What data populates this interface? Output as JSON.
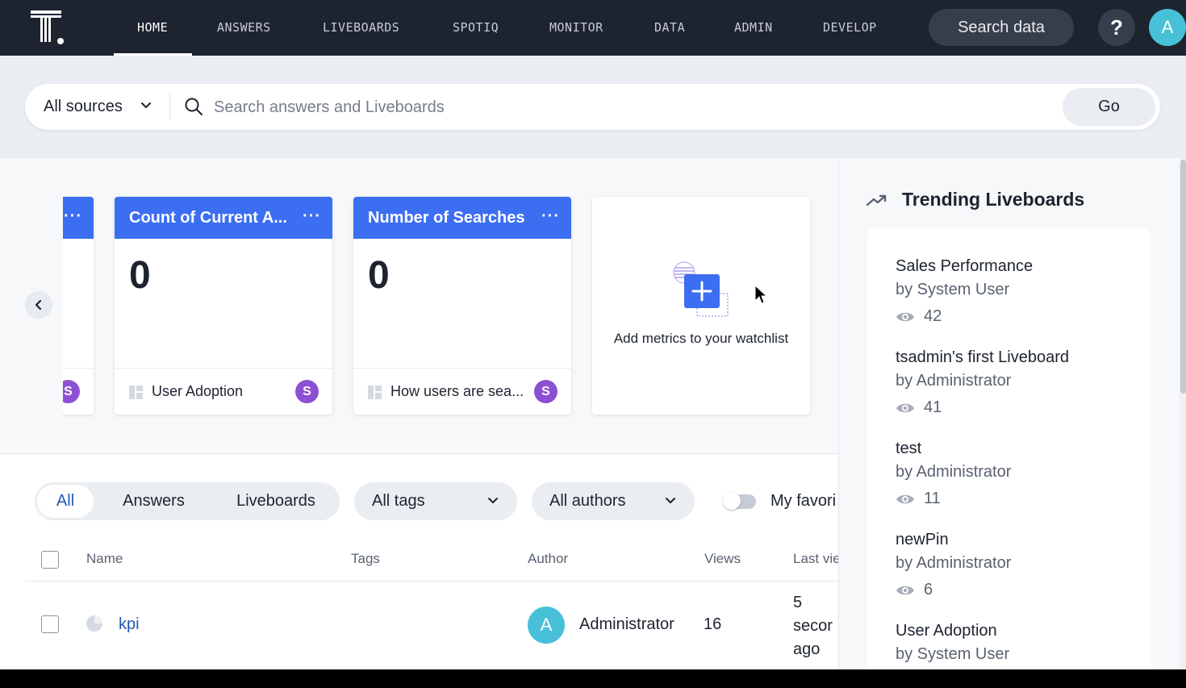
{
  "topnav": {
    "tabs": [
      "HOME",
      "ANSWERS",
      "LIVEBOARDS",
      "SPOTIQ",
      "MONITOR",
      "DATA",
      "ADMIN",
      "DEVELOP"
    ],
    "active_tab": "HOME",
    "search_data_label": "Search data",
    "help_label": "?",
    "avatar_initial": "A"
  },
  "search": {
    "sources_label": "All sources",
    "placeholder": "Search answers and Liveboards",
    "go_label": "Go"
  },
  "watchlist": {
    "partial_card": {
      "more": "···",
      "badge": "S"
    },
    "cards": [
      {
        "title": "Count of Current A...",
        "more": "···",
        "value": "0",
        "source": "User Adoption",
        "badge": "S"
      },
      {
        "title": "Number of Searches",
        "more": "···",
        "value": "0",
        "source": "How users are sea...",
        "badge": "S"
      }
    ],
    "add_text": "Add metrics to your watchlist"
  },
  "filters": {
    "segments": [
      "All",
      "Answers",
      "Liveboards"
    ],
    "active_segment": "All",
    "tags_label": "All tags",
    "authors_label": "All authors",
    "favorites_label": "My favori",
    "favorites_on": false
  },
  "table": {
    "columns": {
      "name": "Name",
      "tags": "Tags",
      "author": "Author",
      "views": "Views",
      "last_viewed": "Last vie"
    },
    "rows": [
      {
        "name": "kpi",
        "author_initial": "A",
        "author": "Administrator",
        "views": "16",
        "last_viewed": [
          "5",
          "secor",
          "ago"
        ]
      }
    ]
  },
  "trending": {
    "title": "Trending Liveboards",
    "items": [
      {
        "title": "Sales Performance",
        "by": "by System User",
        "views": "42"
      },
      {
        "title": "tsadmin's first Liveboard",
        "by": "by Administrator",
        "views": "41"
      },
      {
        "title": "test",
        "by": "by Administrator",
        "views": "11"
      },
      {
        "title": "newPin",
        "by": "by Administrator",
        "views": "6"
      },
      {
        "title": "User Adoption",
        "by": "by System User",
        "views": ""
      }
    ]
  },
  "colors": {
    "nav_bg": "#1d232f",
    "card_header": "#3c6ef2",
    "badge": "#8d4fd3",
    "avatar": "#48c0d8",
    "link": "#2359b3"
  }
}
